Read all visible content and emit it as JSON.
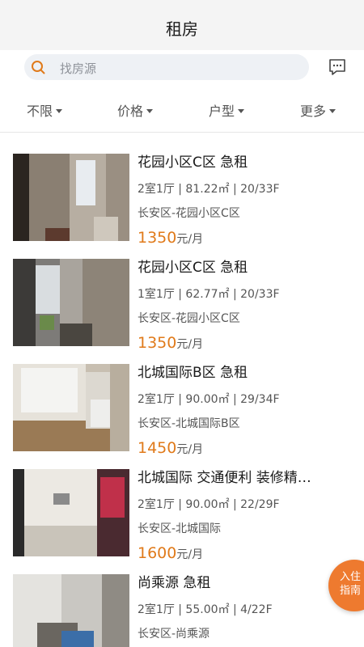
{
  "header": {
    "title": "租房"
  },
  "search": {
    "placeholder": "找房源"
  },
  "filters": [
    {
      "label": "不限"
    },
    {
      "label": "价格"
    },
    {
      "label": "户型"
    },
    {
      "label": "更多"
    }
  ],
  "listings": [
    {
      "title": "花园小区C区 急租",
      "specs": "2室1厅 | 81.22㎡ | 20/33F",
      "location": "长安区-花园小区C区",
      "price": "1350",
      "unit": "元/月"
    },
    {
      "title": "花园小区C区 急租",
      "specs": "1室1厅 | 62.77㎡ | 20/33F",
      "location": "长安区-花园小区C区",
      "price": "1350",
      "unit": "元/月"
    },
    {
      "title": "北城国际B区 急租",
      "specs": "2室1厅 | 90.00㎡ | 29/34F",
      "location": "长安区-北城国际B区",
      "price": "1450",
      "unit": "元/月"
    },
    {
      "title": "北城国际 交通便利 装修精…",
      "specs": "2室1厅 | 90.00㎡ | 22/29F",
      "location": "长安区-北城国际",
      "price": "1600",
      "unit": "元/月"
    },
    {
      "title": "尚乘源 急租",
      "specs": "2室1厅 | 55.00㎡ | 4/22F",
      "location": "长安区-尚乘源",
      "price": "",
      "unit": ""
    }
  ],
  "float_button": {
    "line1": "入住",
    "line2": "指南"
  },
  "colors": {
    "accent": "#e07a1a",
    "float": "#ee7a2f",
    "search_bg": "#eef1f5"
  }
}
